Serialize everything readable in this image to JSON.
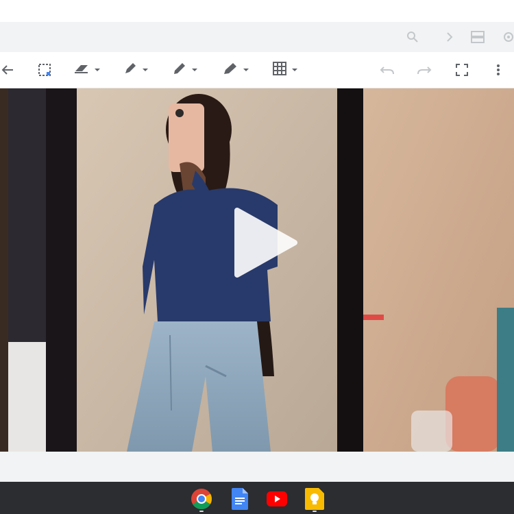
{
  "upper_bar": {
    "icons": [
      "search-icon",
      "chevron-right-icon",
      "view-toggle-icon",
      "settings-icon"
    ]
  },
  "toolbar": {
    "tools": [
      "back-arrow-icon",
      "select-icon",
      "eraser-icon",
      "marker-icon",
      "pen-icon",
      "highlighter-icon",
      "grid-icon",
      "undo-icon",
      "redo-icon",
      "fullscreen-icon",
      "more-vert-icon"
    ]
  },
  "media": {
    "type": "video",
    "play_icon": "play-icon"
  },
  "shelf": {
    "apps": [
      "chrome-icon",
      "docs-icon",
      "youtube-icon",
      "keep-icon"
    ],
    "colors": {
      "background": "#2b2d30",
      "chrome_red": "#db4437",
      "chrome_yellow": "#f4b400",
      "chrome_green": "#0f9d58",
      "chrome_blue": "#4285f4",
      "docs_blue": "#4285f4",
      "youtube_red": "#ff0000",
      "keep_yellow": "#f9bb02"
    }
  }
}
